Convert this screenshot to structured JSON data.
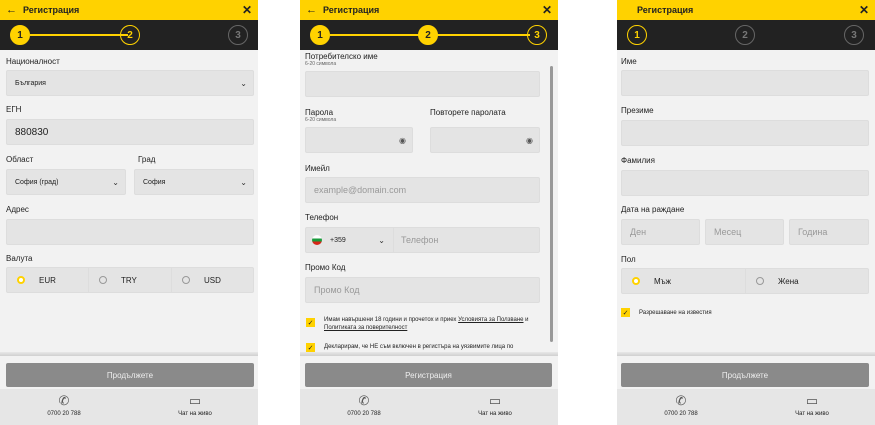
{
  "header": {
    "title": "Регистрация",
    "back_icon": "arrow-left-icon",
    "close_icon": "close-icon"
  },
  "steps": [
    "1",
    "2",
    "3"
  ],
  "footer": {
    "phone": "0700 20 788",
    "chat": "Чат на живо"
  },
  "step1": {
    "nationality_label": "Националност",
    "nationality_value": "България",
    "egn_label": "ЕГН",
    "egn_value": "880830",
    "region_label": "Област",
    "region_value": "София (град)",
    "city_label": "Град",
    "city_value": "София",
    "address_label": "Адрес",
    "currency_label": "Валута",
    "currencies": [
      "EUR",
      "TRY",
      "USD"
    ],
    "selected_currency": "EUR",
    "continue_label": "Продължете"
  },
  "step2": {
    "username_label": "Потребителско име",
    "username_hint": "6-20 символа",
    "password_label": "Парола",
    "password_hint": "6-20 символа",
    "repeat_password_label": "Повторете паролата",
    "email_label": "Имейл",
    "email_placeholder": "example@domain.com",
    "phone_label": "Телефон",
    "phone_code": "+359",
    "phone_placeholder": "Телефон",
    "promo_label": "Промо Код",
    "promo_placeholder": "Промо Код",
    "consent_text_1": "Имам навършени 18 години и прочетох и приех ",
    "terms_link": "Условията за Ползване",
    "consent_and": " и ",
    "privacy_link": "Политиката за поверителност",
    "declare_text": "Декларирам, че НЕ съм включен в регистъра на уязвимите лица по",
    "register_label": "Регистрация"
  },
  "step3": {
    "first_name_label": "Име",
    "middle_name_label": "Презиме",
    "last_name_label": "Фамилия",
    "dob_label": "Дата на раждане",
    "day_placeholder": "Ден",
    "month_placeholder": "Месец",
    "year_placeholder": "Година",
    "gender_label": "Пол",
    "male": "Мъж",
    "female": "Жена",
    "notifications_label": "Разрешаване на известия",
    "continue_label": "Продължете"
  },
  "colors": {
    "accent": "#ffd200",
    "dark": "#222222",
    "button": "#8a8a8a"
  }
}
